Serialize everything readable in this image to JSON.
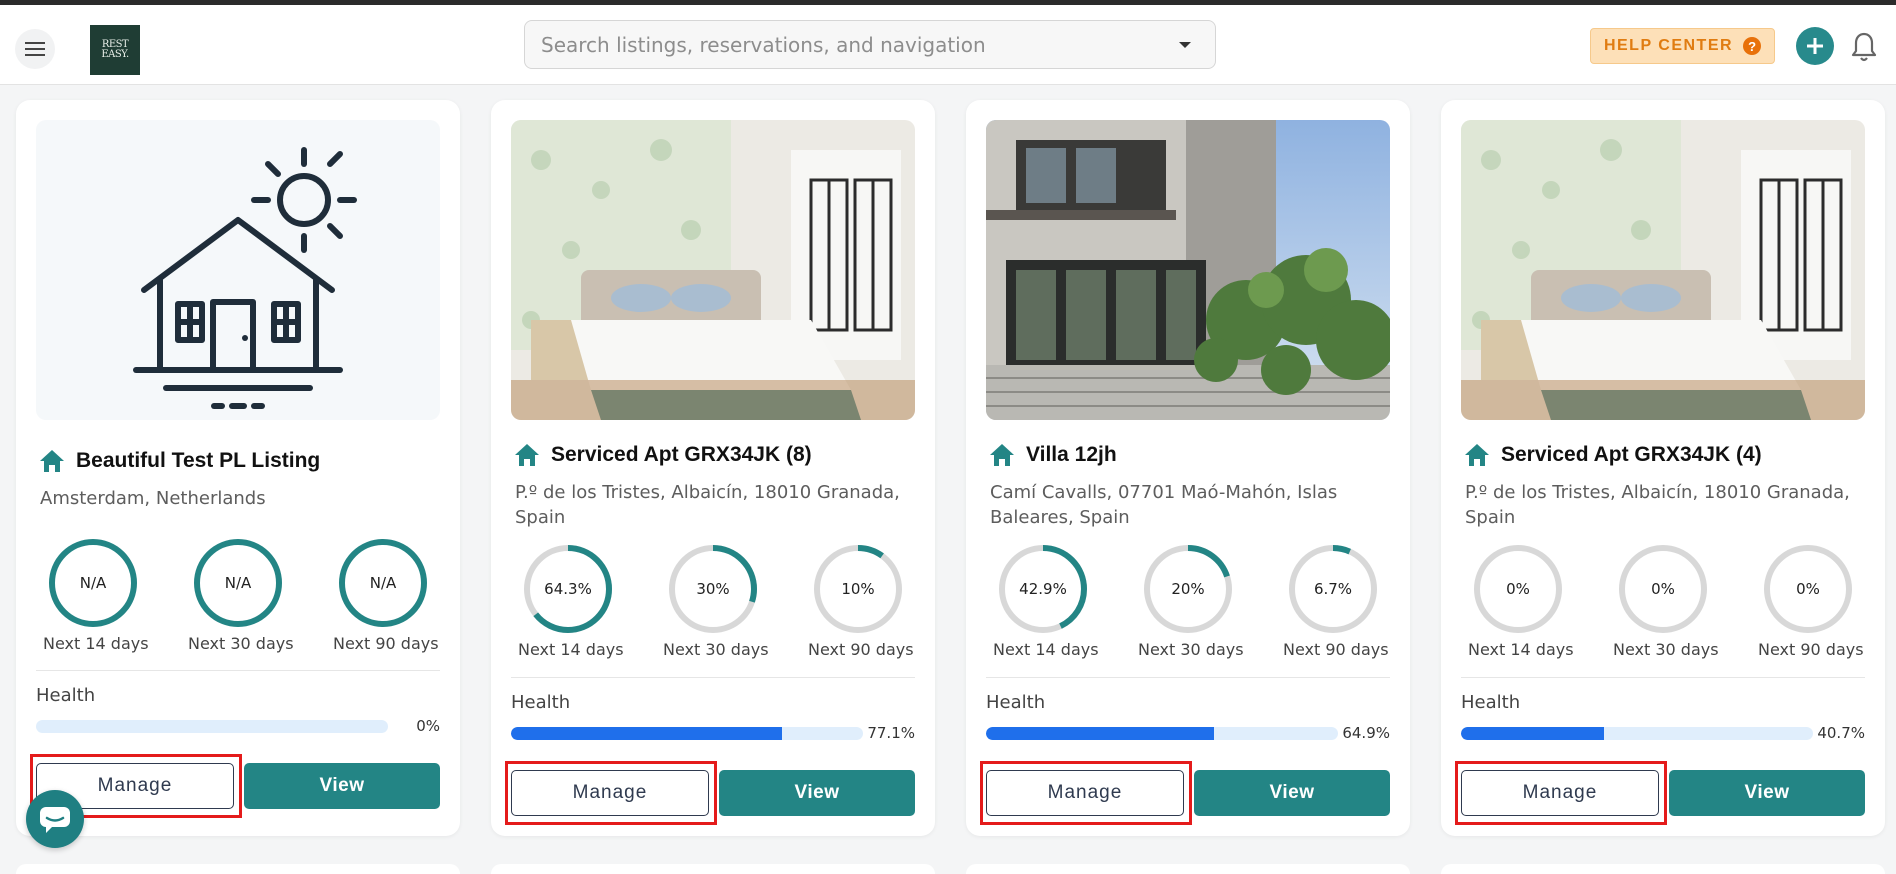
{
  "header": {
    "search_placeholder": "Search listings, reservations, and navigation",
    "help_label": "HELP CENTER",
    "help_icon": "?",
    "logo_line1": "REST",
    "logo_line2": "EASY."
  },
  "colors": {
    "teal": "#238585",
    "help_bg": "#fde0b8",
    "help_text": "#e07c11",
    "health_bar": "#1f6feb",
    "highlight": "#e41b1b"
  },
  "listings": [
    {
      "title": "Beautiful Test PL Listing",
      "address": "Amsterdam, Netherlands",
      "photo": "house-sun-illustration",
      "occupancy": [
        {
          "value": "N/A",
          "fraction": 1,
          "label": "Next 14 days"
        },
        {
          "value": "N/A",
          "fraction": 1,
          "label": "Next 30 days"
        },
        {
          "value": "N/A",
          "fraction": 1,
          "label": "Next 90 days"
        }
      ],
      "health_label": "Health",
      "health_value": "0%",
      "health_fraction": 0,
      "manage_label": "Manage",
      "view_label": "View"
    },
    {
      "title": "Serviced Apt GRX34JK (8)",
      "address": "P.º de los Tristes, Albaicín, 18010 Granada, Spain",
      "photo": "bedroom-photo",
      "occupancy": [
        {
          "value": "64.3%",
          "fraction": 0.643,
          "label": "Next 14 days"
        },
        {
          "value": "30%",
          "fraction": 0.3,
          "label": "Next 30 days"
        },
        {
          "value": "10%",
          "fraction": 0.1,
          "label": "Next 90 days"
        }
      ],
      "health_label": "Health",
      "health_value": "77.1%",
      "health_fraction": 0.771,
      "manage_label": "Manage",
      "view_label": "View"
    },
    {
      "title": "Villa 12jh",
      "address": "Camí Cavalls, 07701 Maó-Mahón, Islas Baleares, Spain",
      "photo": "villa-photo",
      "occupancy": [
        {
          "value": "42.9%",
          "fraction": 0.429,
          "label": "Next 14 days"
        },
        {
          "value": "20%",
          "fraction": 0.2,
          "label": "Next 30 days"
        },
        {
          "value": "6.7%",
          "fraction": 0.067,
          "label": "Next 90 days"
        }
      ],
      "health_label": "Health",
      "health_value": "64.9%",
      "health_fraction": 0.649,
      "manage_label": "Manage",
      "view_label": "View"
    },
    {
      "title": "Serviced Apt GRX34JK (4)",
      "address": "P.º de los Tristes, Albaicín, 18010 Granada, Spain",
      "photo": "bedroom-photo",
      "occupancy": [
        {
          "value": "0%",
          "fraction": 0,
          "label": "Next 14 days"
        },
        {
          "value": "0%",
          "fraction": 0,
          "label": "Next 30 days"
        },
        {
          "value": "0%",
          "fraction": 0,
          "label": "Next 90 days"
        }
      ],
      "health_label": "Health",
      "health_value": "40.7%",
      "health_fraction": 0.407,
      "manage_label": "Manage",
      "view_label": "View"
    }
  ]
}
